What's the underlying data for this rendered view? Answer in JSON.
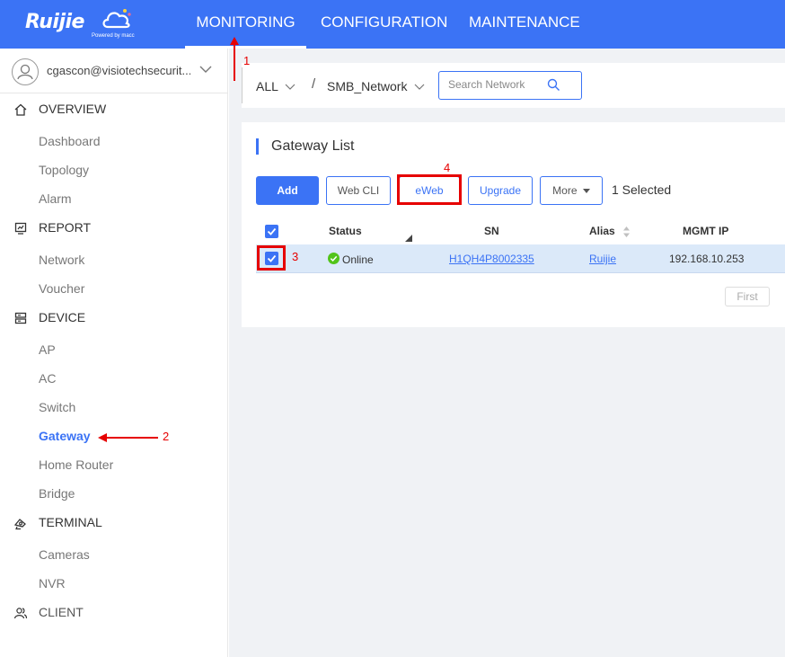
{
  "brand": {
    "name": "Ruijie",
    "tagline": "Powered by macc"
  },
  "nav": {
    "tabs": [
      "MONITORING",
      "CONFIGURATION",
      "MAINTENANCE"
    ],
    "active": "MONITORING"
  },
  "account": {
    "email": "cgascon@visiotechsecurit..."
  },
  "sidebar": {
    "sections": [
      {
        "label": "OVERVIEW",
        "icon": "home-icon",
        "items": [
          "Dashboard",
          "Topology",
          "Alarm"
        ]
      },
      {
        "label": "REPORT",
        "icon": "report-icon",
        "items": [
          "Network",
          "Voucher"
        ]
      },
      {
        "label": "DEVICE",
        "icon": "device-icon",
        "items": [
          "AP",
          "AC",
          "Switch",
          "Gateway",
          "Home Router",
          "Bridge"
        ]
      },
      {
        "label": "TERMINAL",
        "icon": "terminal-icon",
        "items": [
          "Cameras",
          "NVR"
        ]
      },
      {
        "label": "CLIENT",
        "icon": "client-icon",
        "items": []
      }
    ],
    "active_item": "Gateway"
  },
  "filter": {
    "scope": "ALL",
    "separator": "/",
    "network": "SMB_Network",
    "search_placeholder": "Search Network"
  },
  "gateway_list": {
    "title": "Gateway List",
    "buttons": {
      "add": "Add",
      "web_cli": "Web CLI",
      "eweb": "eWeb",
      "upgrade": "Upgrade",
      "more": "More"
    },
    "selected_text": "1 Selected",
    "columns": [
      "Status",
      "SN",
      "Alias",
      "MGMT IP"
    ],
    "rows": [
      {
        "status": "Online",
        "sn": "H1QH4P8002335",
        "alias": "Ruijie",
        "mgmt_ip": "192.168.10.253"
      }
    ],
    "pagination": {
      "first": "First"
    }
  },
  "annotations": [
    "1",
    "2",
    "3",
    "4"
  ],
  "colors": {
    "accent": "#3b73f5",
    "annotation": "#e60000",
    "online": "#52c41a",
    "selected_row": "#dbe9f9"
  }
}
